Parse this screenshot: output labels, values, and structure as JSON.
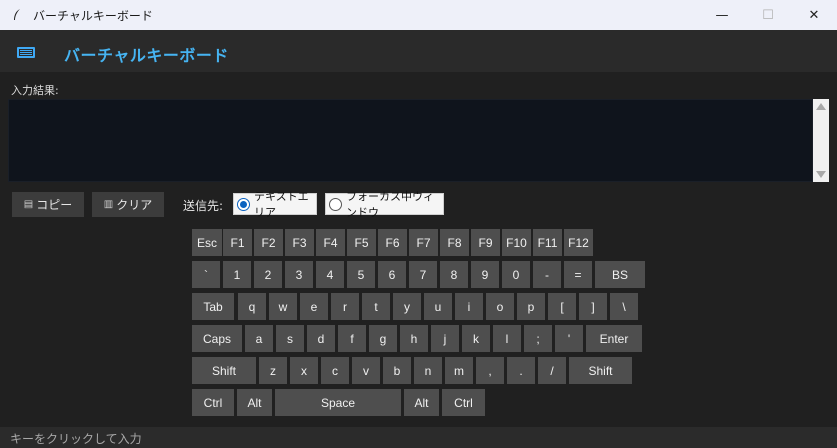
{
  "window": {
    "title": "バーチャルキーボード",
    "min_glyph": "—",
    "max_glyph": "☐",
    "close_glyph": "✕"
  },
  "header": {
    "icon": "keyboard-icon",
    "title": "バーチャルキーボード",
    "accent_color": "#46b4f2"
  },
  "output": {
    "label": "入力結果:",
    "value": ""
  },
  "toolbar": {
    "copy_icon": "clipboard-icon",
    "copy_label": "コピー",
    "clear_icon": "trash-icon",
    "clear_label": "クリア",
    "send_to_label": "送信先:",
    "radio_text_area": "テキストエリア",
    "radio_focus_window": "フォーカス中ウィンドウ",
    "selected": "テキストエリア"
  },
  "keyboard": {
    "rows": [
      [
        "Esc",
        "F1",
        "F2",
        "F3",
        "F4",
        "F5",
        "F6",
        "F7",
        "F8",
        "F9",
        "F10",
        "F11",
        "F12"
      ],
      [
        "`",
        "1",
        "2",
        "3",
        "4",
        "5",
        "6",
        "7",
        "8",
        "9",
        "0",
        "-",
        "=",
        "BS"
      ],
      [
        "Tab",
        "q",
        "w",
        "e",
        "r",
        "t",
        "y",
        "u",
        "i",
        "o",
        "p",
        "[",
        "]",
        "\\"
      ],
      [
        "Caps",
        "a",
        "s",
        "d",
        "f",
        "g",
        "h",
        "j",
        "k",
        "l",
        ";",
        "'",
        "Enter"
      ],
      [
        "Shift",
        "z",
        "x",
        "c",
        "v",
        "b",
        "n",
        "m",
        ",",
        ".",
        "/",
        "Shift"
      ],
      [
        "Ctrl",
        "Alt",
        "Space",
        "Alt",
        "Ctrl"
      ]
    ]
  },
  "status": {
    "text": "キーをクリックして入力"
  }
}
